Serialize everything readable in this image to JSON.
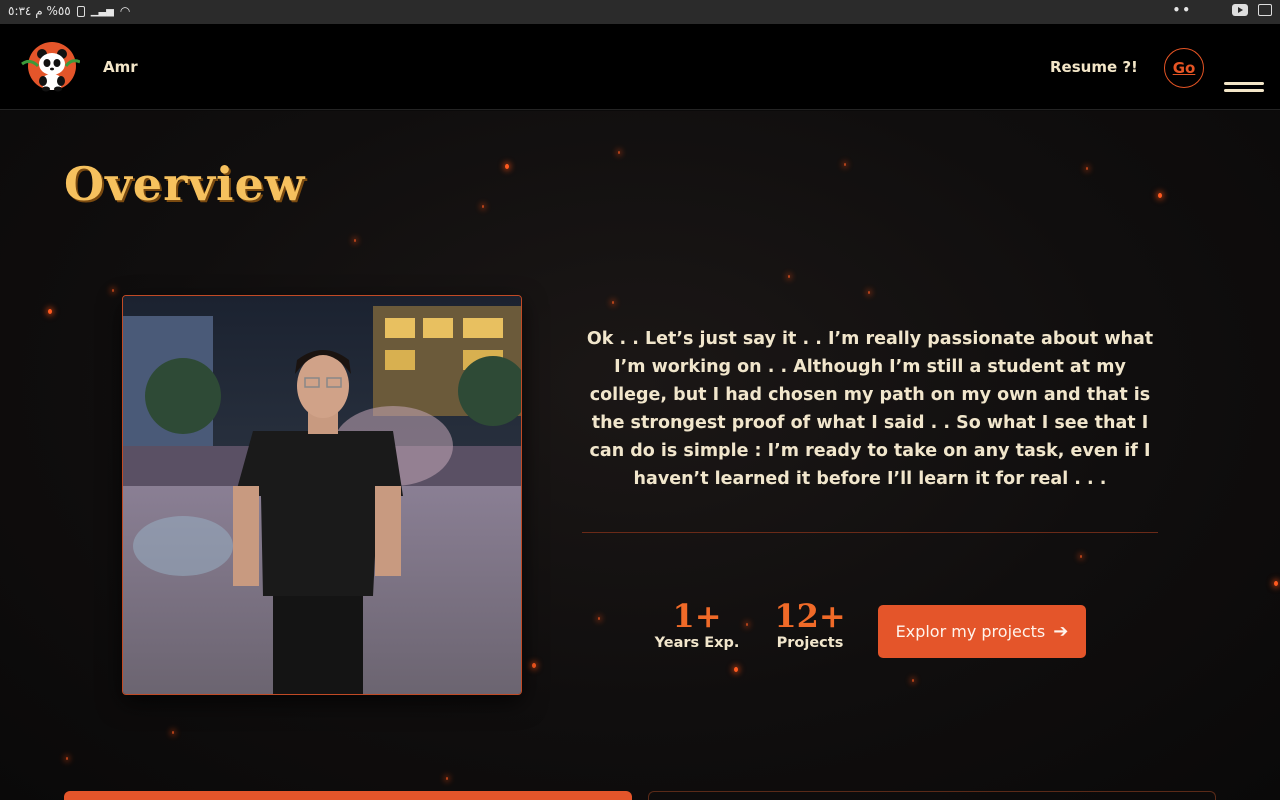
{
  "statusbar": {
    "left_text": "م ٥:٣٤ ‎%٥٥",
    "right_dots": "••"
  },
  "header": {
    "brand": "Amr",
    "resume_label": "Resume ?!",
    "go_label": "Go"
  },
  "overview": {
    "title": "Overview",
    "paragraph": "Ok . . Let’s just say it . . I’m really passionate about what I’m working on . . Although I’m still a student at my college, but I had chosen my path on my own and that is the strongest proof of what I said . . So what I see that I can do is simple : I’m ready to take on any task, even if I haven’t learned it before I’ll learn it for real . . .",
    "stats": [
      {
        "value": "1+",
        "label": "Years Exp."
      },
      {
        "value": "12+",
        "label": "Projects"
      }
    ],
    "cta_label": "Explor my projects",
    "cta_icon": "arrow-right-icon"
  },
  "colors": {
    "accent": "#e4552a",
    "title": "#f6c15e",
    "text": "#f1e6cc",
    "background": "#0b0a0a"
  }
}
